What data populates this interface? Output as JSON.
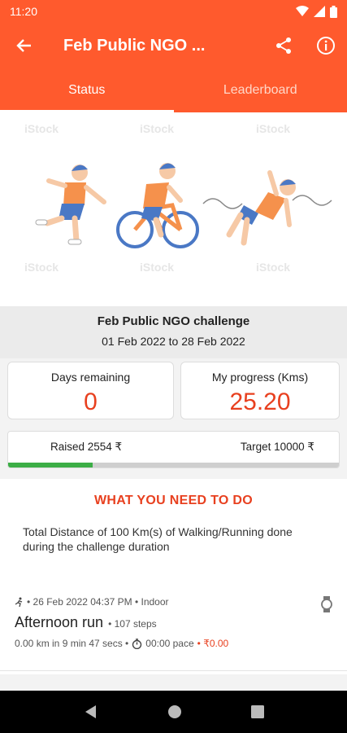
{
  "status_bar": {
    "time": "11:20",
    "icons": [
      "wifi-icon",
      "signal-icon",
      "battery-icon"
    ]
  },
  "app_bar": {
    "title": "Feb Public NGO ...",
    "icons": [
      "back-arrow-icon",
      "share-icon",
      "info-icon"
    ]
  },
  "tabs": [
    {
      "label": "Status",
      "active": true
    },
    {
      "label": "Leaderboard",
      "active": false
    }
  ],
  "banner": {
    "watermark": "iStock"
  },
  "challenge": {
    "name": "Feb Public NGO challenge",
    "dates": "01 Feb 2022 to 28 Feb 2022"
  },
  "days": {
    "label": "Days remaining",
    "value": "0"
  },
  "progress": {
    "label": "My progress (Kms)",
    "value": "25.20"
  },
  "fundraise": {
    "raised": "Raised 2554 ₹",
    "target": "Target 10000 ₹",
    "fraction": 0.2554
  },
  "todo": {
    "heading": "WHAT YOU NEED TO DO",
    "description": "Total Distance of 100 Km(s) of Walking/Running done during the challenge duration"
  },
  "activity": {
    "meta": "• 26 Feb 2022 04:37 PM • Indoor",
    "title": "Afternoon run",
    "steps": "• 107 steps",
    "distance": "0.00 km in 9 min 47 secs  •",
    "pace": "00:00 pace",
    "amount": "• ₹0.00"
  },
  "colors": {
    "accent": "#ff5a2d",
    "value": "#e8401f",
    "progress": "#3cae46"
  }
}
